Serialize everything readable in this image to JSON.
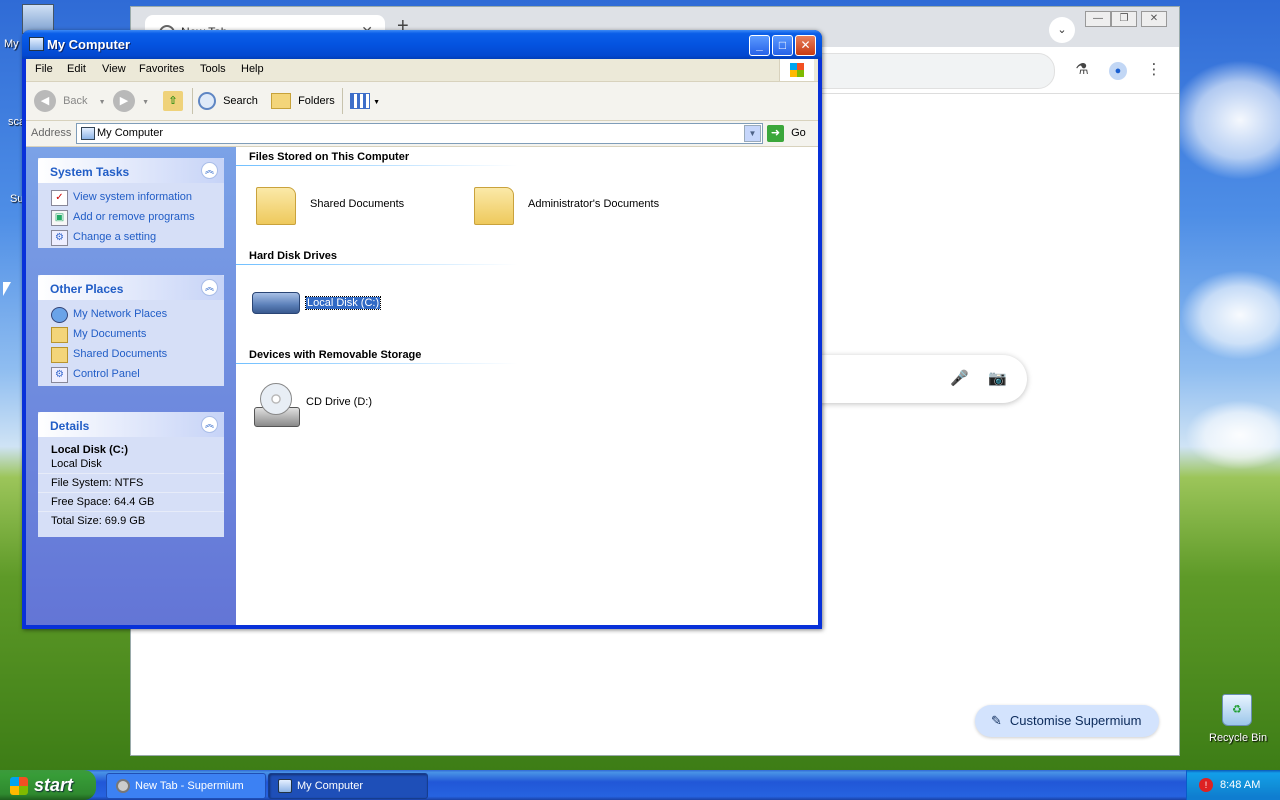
{
  "desktop": {
    "icons": [
      {
        "label": "My"
      },
      {
        "label": "sca"
      },
      {
        "label": "Su"
      },
      {
        "label": "Recycle Bin"
      }
    ]
  },
  "browser": {
    "tab_title": "New Tab",
    "tab_close": "✕",
    "new_tab": "+",
    "customise_label": "Customise Supermium"
  },
  "window": {
    "title": "My Computer",
    "menu": [
      "File",
      "Edit",
      "View",
      "Favorites",
      "Tools",
      "Help"
    ],
    "toolbar": {
      "back": "Back",
      "search": "Search",
      "folders": "Folders"
    },
    "address": {
      "label": "Address",
      "value": "My Computer",
      "go": "Go"
    },
    "system_tasks": {
      "title": "System Tasks",
      "items": [
        "View system information",
        "Add or remove programs",
        "Change a setting"
      ]
    },
    "other_places": {
      "title": "Other Places",
      "items": [
        "My Network Places",
        "My Documents",
        "Shared Documents",
        "Control Panel"
      ]
    },
    "details": {
      "title": "Details",
      "name": "Local Disk (C:)",
      "type": "Local Disk",
      "file_system": "File System: NTFS",
      "free_space": "Free Space: 64.4 GB",
      "total_size": "Total Size: 69.9 GB"
    },
    "groups": [
      {
        "header": "Files Stored on This Computer",
        "items": [
          "Shared Documents",
          "Administrator's Documents"
        ]
      },
      {
        "header": "Hard Disk Drives",
        "items": [
          "Local Disk (C:)"
        ]
      },
      {
        "header": "Devices with Removable Storage",
        "items": [
          "CD Drive (D:)"
        ]
      }
    ]
  },
  "taskbar": {
    "start": "start",
    "tasks": [
      "New Tab - Supermium",
      "My Computer"
    ],
    "clock": "8:48 AM"
  },
  "colors": {
    "xp_blue": "#0453e0",
    "task_link": "#215dc6",
    "selection": "#316ac5"
  }
}
